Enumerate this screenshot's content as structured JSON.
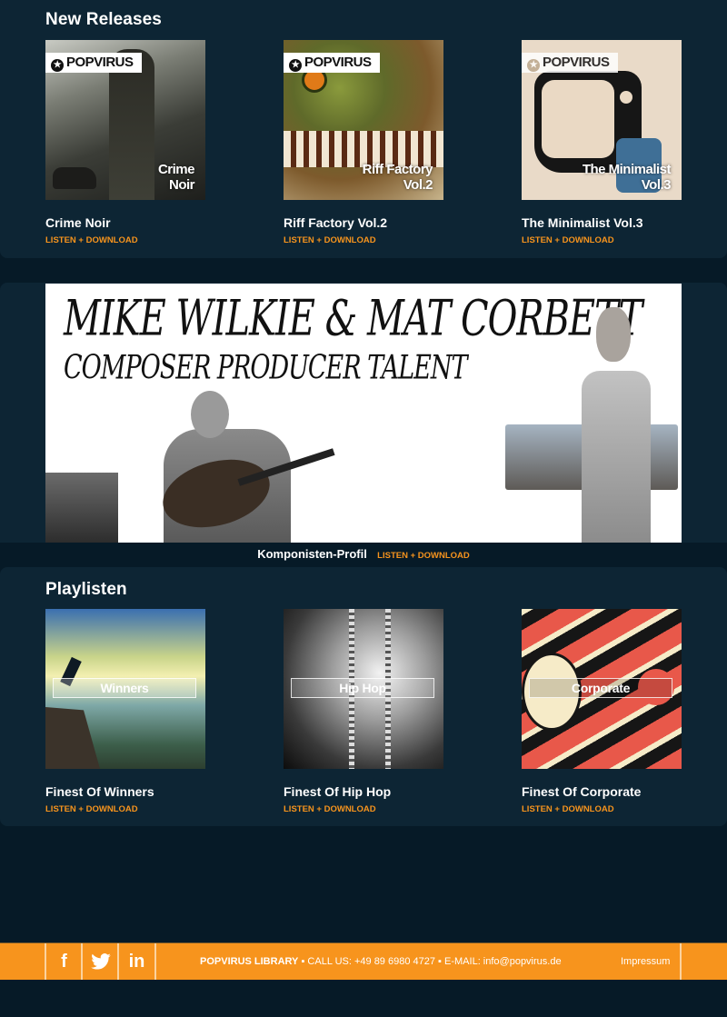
{
  "new_releases": {
    "title": "New Releases",
    "brand_tag": "POPVIRUS",
    "items": [
      {
        "title": "Crime Noir",
        "cover_text_1": "Crime",
        "cover_text_2": "Noir",
        "link": "LISTEN + DOWNLOAD"
      },
      {
        "title": "Riff Factory Vol.2",
        "cover_text_1": "Riff Factory",
        "cover_text_2": "Vol.2",
        "link": "LISTEN + DOWNLOAD"
      },
      {
        "title": "The Minimalist Vol.3",
        "cover_text_1": "The Minimalist",
        "cover_text_2": "Vol.3",
        "link": "LISTEN + DOWNLOAD"
      }
    ]
  },
  "banner": {
    "headline_1": "MIKE WILKIE & MAT CORBETT",
    "headline_2": "COMPOSER PRODUCER TALENT",
    "caption": "Komponisten-Profil",
    "link": "LISTEN + DOWNLOAD"
  },
  "playlists": {
    "title": "Playlisten",
    "items": [
      {
        "title": "Finest Of Winners",
        "cover_label": "Winners",
        "link": "LISTEN + DOWNLOAD"
      },
      {
        "title": "Finest Of Hip Hop",
        "cover_label": "Hip Hop",
        "link": "LISTEN + DOWNLOAD"
      },
      {
        "title": "Finest Of Corporate",
        "cover_label": "Corporate",
        "link": "LISTEN + DOWNLOAD"
      }
    ]
  },
  "footer": {
    "social": [
      {
        "name": "facebook",
        "glyph": "f"
      },
      {
        "name": "twitter",
        "glyph": "🐦"
      },
      {
        "name": "linkedin",
        "glyph": "in"
      }
    ],
    "brand": "POPVIRUS LIBRARY",
    "sep": "▪",
    "call": "CALL US: +49 89 6980 4727",
    "email": "E-MAIL: info@popvirus.de",
    "impressum": "Impressum"
  },
  "colors": {
    "accent": "#f7941d",
    "panel": "#0d2534",
    "page_bg": "#061a27"
  }
}
